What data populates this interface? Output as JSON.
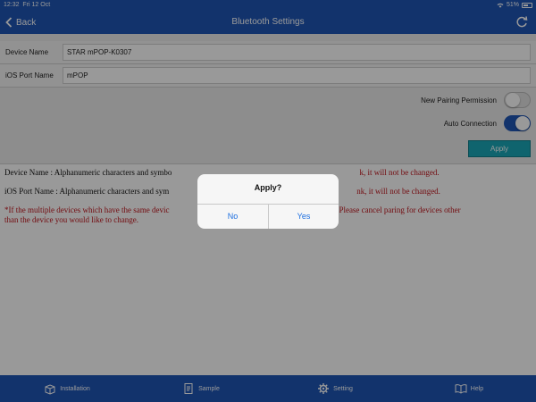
{
  "status_bar": {
    "time": "12:32",
    "date": "Fri 12 Oct",
    "battery": "51%"
  },
  "nav": {
    "back_label": "Back",
    "title": "Bluetooth Settings"
  },
  "form": {
    "device_name_label": "Device Name",
    "device_name_value": "STAR mPOP-K0307",
    "ios_port_name_label": "iOS Port Name",
    "ios_port_name_value": "mPOP",
    "new_pairing_label": "New Pairing Permission",
    "new_pairing_on": false,
    "auto_connection_label": "Auto Connection",
    "auto_connection_on": true,
    "apply_label": "Apply"
  },
  "info": {
    "line1_prefix": "Device Name : Alphanumeric characters and symbo",
    "line1_suffix": "k, it will not be changed.",
    "line2_prefix": "iOS Port Name : Alphanumeric characters and sym",
    "line2_suffix": "nk, it will not be changed.",
    "note_line1_prefix": "*If the multiple devices which have the same devic",
    "note_line1_suffix": "settings. Please cancel paring for devices other",
    "note_line2": "than the device you would like to change."
  },
  "alert": {
    "title": "Apply?",
    "no_label": "No",
    "yes_label": "Yes"
  },
  "tabs": [
    {
      "label": "Installation",
      "icon": "installation-icon"
    },
    {
      "label": "Sample",
      "icon": "sample-icon"
    },
    {
      "label": "Setting",
      "icon": "gear-icon"
    },
    {
      "label": "Help",
      "icon": "book-icon"
    }
  ],
  "colors": {
    "bar_blue": "#1f56b5",
    "apply_teal": "#1aa7b8",
    "toggle_on": "#1f56b5",
    "info_red": "#c0141c",
    "alert_blue": "#1d6fe0"
  }
}
